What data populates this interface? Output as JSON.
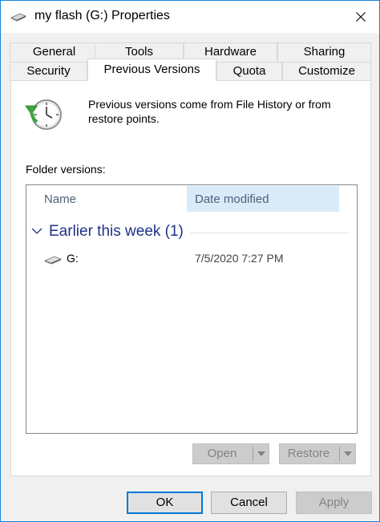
{
  "window": {
    "title": "my flash (G:) Properties",
    "icon": "usb-drive-icon",
    "close_icon": "close-icon"
  },
  "tabs": {
    "row1": [
      "General",
      "Tools",
      "Hardware",
      "Sharing"
    ],
    "row2": [
      "Security",
      "Previous Versions",
      "Quota",
      "Customize"
    ],
    "selected": "Previous Versions"
  },
  "panel": {
    "info_text": "Previous versions come from File History or from restore points.",
    "folder_versions_label": "Folder versions:",
    "columns": {
      "name": "Name",
      "date": "Date modified"
    },
    "group": {
      "title": "Earlier this week (1)"
    },
    "items": [
      {
        "name": "G:",
        "date": "7/5/2020 7:27 PM",
        "icon": "usb-drive-icon"
      }
    ],
    "open_button": "Open",
    "restore_button": "Restore"
  },
  "buttons": {
    "ok": "OK",
    "cancel": "Cancel",
    "apply": "Apply"
  },
  "colors": {
    "accent": "#0078d7",
    "group_title": "#1e3287",
    "sorted_column": "#d9ebf9",
    "clock_arrow": "#3aa83a"
  }
}
